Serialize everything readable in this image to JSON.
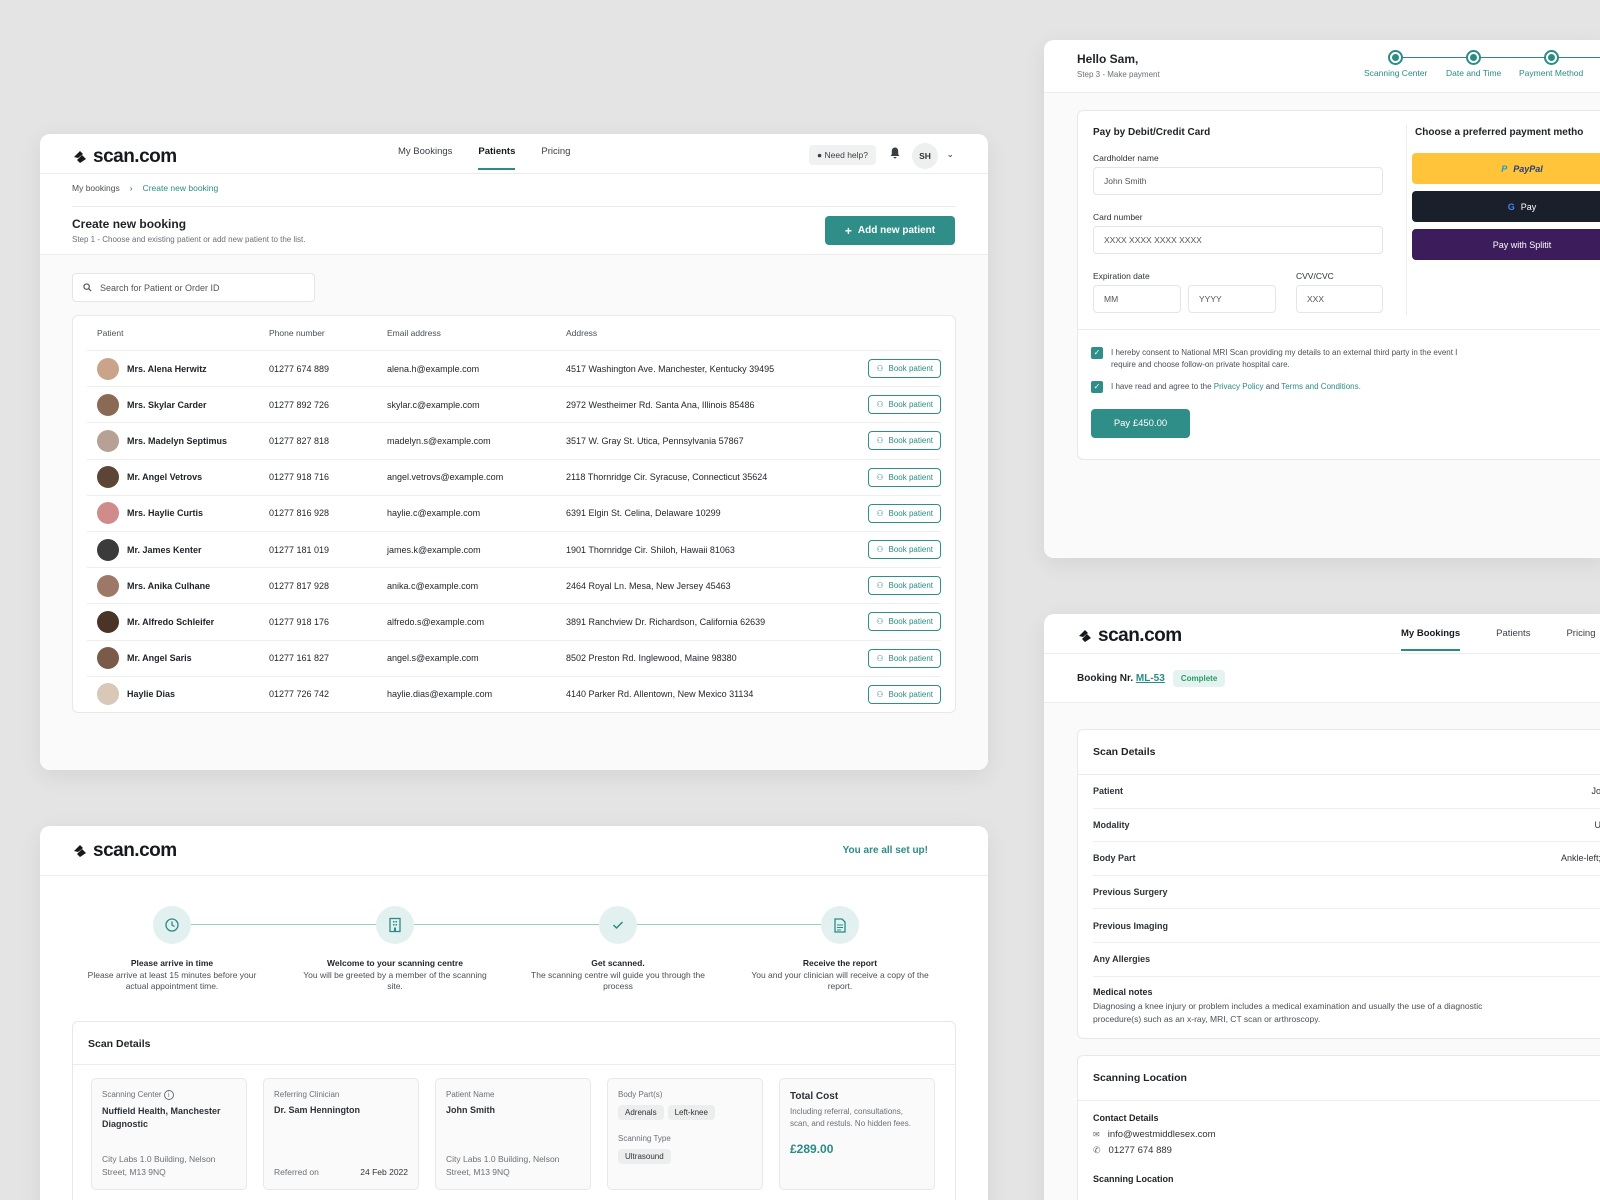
{
  "brand": "scan.com",
  "colors": {
    "teal": "#2f8f88",
    "paypal": "#ffc439",
    "gpay": "#1a1f2c",
    "splitit": "#3d1c5c"
  },
  "patients_card": {
    "nav": [
      "My Bookings",
      "Patients",
      "Pricing"
    ],
    "help": "Need help?",
    "initials": "SH",
    "breadcrumb": [
      "My bookings",
      "Create new booking"
    ],
    "title": "Create new booking",
    "subtitle": "Step 1 - Choose and existing patient or add new patient to the list.",
    "add_button": "Add new patient",
    "search_placeholder": "Search for Patient or Order ID",
    "headers": [
      "Patient",
      "Phone number",
      "Email address",
      "Address"
    ],
    "book_label": "Book patient",
    "rows": [
      {
        "name": "Mrs. Alena Herwitz",
        "phone": "01277 674 889",
        "email": "alena.h@example.com",
        "address": "4517 Washington Ave. Manchester, Kentucky 39495",
        "tone": "#c9a48a"
      },
      {
        "name": "Mrs. Skylar Carder",
        "phone": "01277 892 726",
        "email": "skylar.c@example.com",
        "address": "2972 Westheimer Rd. Santa Ana, Illinois 85486",
        "tone": "#8a6a55"
      },
      {
        "name": "Mrs. Madelyn Septimus",
        "phone": "01277 827 818",
        "email": "madelyn.s@example.com",
        "address": "3517 W. Gray St. Utica, Pennsylvania 57867",
        "tone": "#b7a194"
      },
      {
        "name": "Mr. Angel Vetrovs",
        "phone": "01277 918 716",
        "email": "angel.vetrovs@example.com",
        "address": "2118 Thornridge Cir. Syracuse, Connecticut 35624",
        "tone": "#5c4536"
      },
      {
        "name": "Mrs. Haylie Curtis",
        "phone": "01277 816 928",
        "email": "haylie.c@example.com",
        "address": "6391 Elgin St. Celina, Delaware 10299",
        "tone": "#d08c8a"
      },
      {
        "name": "Mr. James Kenter",
        "phone": "01277 181 019",
        "email": "james.k@example.com",
        "address": "1901 Thornridge Cir. Shiloh, Hawaii 81063",
        "tone": "#3b3b3b"
      },
      {
        "name": "Mrs. Anika Culhane",
        "phone": "01277 817 928",
        "email": "anika.c@example.com",
        "address": "2464 Royal Ln. Mesa, New Jersey 45463",
        "tone": "#9e7866"
      },
      {
        "name": "Mr. Alfredo Schleifer",
        "phone": "01277 918 176",
        "email": "alfredo.s@example.com",
        "address": "3891 Ranchview Dr. Richardson, California 62639",
        "tone": "#4a3428"
      },
      {
        "name": "Mr. Angel Saris",
        "phone": "01277 161 827",
        "email": "angel.s@example.com",
        "address": "8502 Preston Rd. Inglewood, Maine 98380",
        "tone": "#7a5a48"
      },
      {
        "name": "Haylie Dias",
        "phone": "01277 726 742",
        "email": "haylie.dias@example.com",
        "address": "4140 Parker Rd. Allentown, New Mexico 31134",
        "tone": "#d9c7b8"
      }
    ]
  },
  "payment_card": {
    "greeting": "Hello Sam,",
    "step": "Step 3 - Make payment",
    "steps": [
      "Scanning Center",
      "Date and Time",
      "Payment Method"
    ],
    "title": "Pay by Debit/Credit Card",
    "cardholder_label": "Cardholder name",
    "cardholder_placeholder": "John Smith",
    "cardnumber_label": "Card number",
    "cardnumber_placeholder": "XXXX XXXX XXXX XXXX",
    "expiry_label": "Expiration date",
    "mm": "MM",
    "yyyy": "YYYY",
    "cvv_label": "CVV/CVC",
    "cvv_placeholder": "XXX",
    "methods_title": "Choose a preferred payment metho",
    "paypal": "PayPal",
    "gpay": "Pay",
    "splitit": "Pay with Splitit",
    "consent1": "I hereby consent to National MRI Scan providing my details to an external third party in the event I require and choose follow-on private hospital care.",
    "consent2_a": "I have read and agree to the",
    "privacy": "Privacy Policy",
    "and": "and",
    "terms": "Terms and Conditions.",
    "pay_button": "Pay £450.00"
  },
  "setup_card": {
    "status": "You are all set up!",
    "steps": [
      {
        "title": "Please arrive in time",
        "text": "Please arrive at least 15 minutes before your actual appointment time."
      },
      {
        "title": "Welcome to your scanning centre",
        "text": "You will be greeted by a member of the scanning site."
      },
      {
        "title": "Get scanned.",
        "text": "The scanning centre wil guide you through the process"
      },
      {
        "title": "Receive the report",
        "text": "You and your clinician will receive a copy of the report."
      }
    ],
    "details_title": "Scan Details",
    "center_label": "Scanning Center",
    "center_value": "Nuffield Health, Manchester Diagnostic",
    "center_address": "City Labs 1.0 Building, Nelson Street, M13 9NQ",
    "clinician_label": "Referring Clinician",
    "clinician_value": "Dr. Sam Hennington",
    "referred_label": "Referred on",
    "referred_date": "24 Feb 2022",
    "patient_label": "Patient Name",
    "patient_value": "John Smith",
    "patient_address": "City Labs 1.0 Building, Nelson Street, M13 9NQ",
    "body_label": "Body Part(s)",
    "body_parts": [
      "Adrenals",
      "Left-knee"
    ],
    "type_label": "Scanning Type",
    "type_value": "Ultrasound",
    "cost_title": "Total Cost",
    "cost_desc": "Including referral, consultations, scan, and restuls. No hidden fees.",
    "cost_value": "£289.00"
  },
  "booking_card": {
    "nav": [
      "My Bookings",
      "Patients",
      "Pricing"
    ],
    "booking_label": "Booking Nr.",
    "booking_id": "ML-53",
    "status": "Complete",
    "details_title": "Scan Details",
    "rows": [
      {
        "k": "Patient",
        "v": "Jo"
      },
      {
        "k": "Modality",
        "v": "U"
      },
      {
        "k": "Body Part",
        "v": "Ankle-left;"
      },
      {
        "k": "Previous Surgery",
        "v": ""
      },
      {
        "k": "Previous Imaging",
        "v": ""
      },
      {
        "k": "Any Allergies",
        "v": ""
      }
    ],
    "notes_label": "Medical notes",
    "notes": "Diagnosing a knee injury or problem includes a medical examination and usually the use of a diagnostic procedure(s) such as an x-ray, MRI, CT scan or arthroscopy.",
    "location_title": "Scanning Location",
    "contact_label": "Contact Details",
    "email": "info@westmiddlesex.com",
    "phone": "01277 674 889",
    "location_label": "Scanning Location"
  }
}
